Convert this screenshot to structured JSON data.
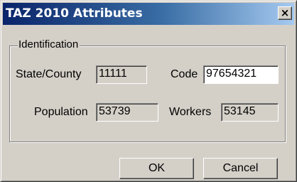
{
  "window": {
    "title": "TAZ 2010 Attributes",
    "close_glyph": "×",
    "close_icon": "close-icon"
  },
  "identification": {
    "group_label": "Identification",
    "state_county_label": "State/County",
    "state_county_value": "11111",
    "code_label": "Code",
    "code_value": "97654321",
    "population_label": "Population",
    "population_value": "53739",
    "workers_label": "Workers",
    "workers_value": "53145"
  },
  "buttons": {
    "ok_label": "OK",
    "cancel_label": "Cancel"
  },
  "colors": {
    "title_bar_start": "#0a246a",
    "title_bar_end": "#a6caf0",
    "dialog_face": "#d4d0c8"
  }
}
